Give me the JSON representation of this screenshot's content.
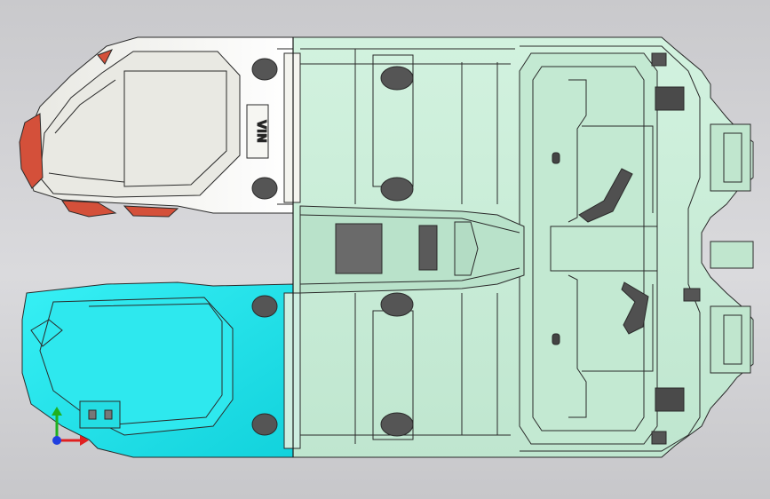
{
  "viewport": {
    "background": "#d3d3d6"
  },
  "model": {
    "part_colors": {
      "center_floor": "#c8ecd6",
      "front_left_panel": "#f2f2ee",
      "front_right_panel": "#1ee6ec",
      "flange_red": "#d4503a",
      "edge_line": "#2a2a2a"
    },
    "stamped_text": "VIN",
    "parts": [
      "center-floor-panel",
      "front-left-floor-panel",
      "front-right-floor-panel",
      "red-flange",
      "center-tunnel",
      "rear-cross-member",
      "seat-bracket-left",
      "seat-bracket-right"
    ]
  },
  "triad": {
    "x_color": "#e02020",
    "y_color": "#20b020",
    "z_color": "#2040e0"
  }
}
